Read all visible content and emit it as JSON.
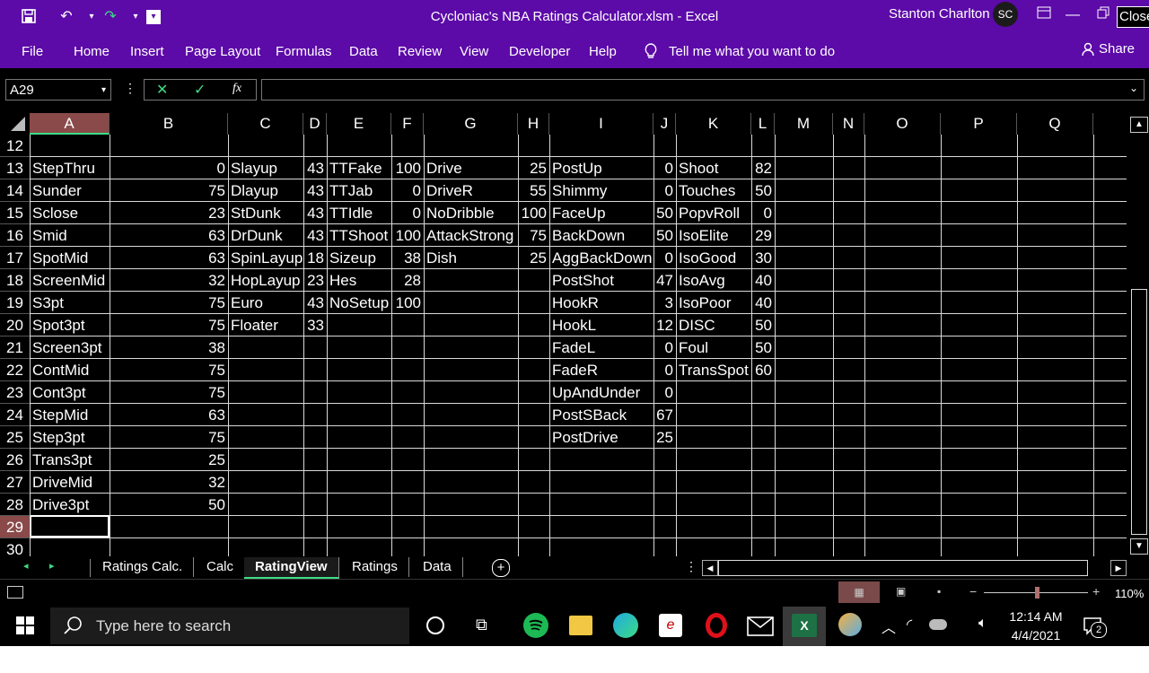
{
  "window": {
    "title": "Cycloniac's NBA Ratings Calculator.xlsm  -  Excel",
    "user_name": "Stanton Charlton",
    "user_initials": "SC",
    "close_label": "Close"
  },
  "ribbon": {
    "tabs": [
      "File",
      "Home",
      "Insert",
      "Page Layout",
      "Formulas",
      "Data",
      "Review",
      "View",
      "Developer",
      "Help"
    ],
    "tell_me": "Tell me what you want to do",
    "share": "Share"
  },
  "formula_bar": {
    "name_box": "A29",
    "fx": "fx",
    "value": ""
  },
  "columns": [
    "A",
    "B",
    "C",
    "D",
    "E",
    "F",
    "G",
    "H",
    "I",
    "J",
    "K",
    "L",
    "M",
    "N",
    "O",
    "P",
    "Q"
  ],
  "rows": [
    {
      "n": "12",
      "cells": [
        "",
        "",
        "",
        "",
        "",
        "",
        "",
        "",
        "",
        "",
        "",
        ""
      ]
    },
    {
      "n": "13",
      "cells": [
        "StepThru",
        "0",
        "Slayup",
        "43",
        "TTFake",
        "100",
        "Drive",
        "25",
        "PostUp",
        "0",
        "Shoot",
        "82"
      ]
    },
    {
      "n": "14",
      "cells": [
        "Sunder",
        "75",
        "Dlayup",
        "43",
        "TTJab",
        "0",
        "DriveR",
        "55",
        "Shimmy",
        "0",
        "Touches",
        "50"
      ]
    },
    {
      "n": "15",
      "cells": [
        "Sclose",
        "23",
        "StDunk",
        "43",
        "TTIdle",
        "0",
        "NoDribble",
        "100",
        "FaceUp",
        "50",
        "PopvRoll",
        "0"
      ]
    },
    {
      "n": "16",
      "cells": [
        "Smid",
        "63",
        "DrDunk",
        "43",
        "TTShoot",
        "100",
        "AttackStrong",
        "75",
        "BackDown",
        "50",
        "IsoElite",
        "29"
      ]
    },
    {
      "n": "17",
      "cells": [
        "SpotMid",
        "63",
        "SpinLayup",
        "18",
        "Sizeup",
        "38",
        "Dish",
        "25",
        "AggBackDown",
        "0",
        "IsoGood",
        "30"
      ]
    },
    {
      "n": "18",
      "cells": [
        "ScreenMid",
        "32",
        "HopLayup",
        "23",
        "Hes",
        "28",
        "",
        "",
        "PostShot",
        "47",
        "IsoAvg",
        "40"
      ]
    },
    {
      "n": "19",
      "cells": [
        "S3pt",
        "75",
        "Euro",
        "43",
        "NoSetup",
        "100",
        "",
        "",
        "HookR",
        "3",
        "IsoPoor",
        "40"
      ]
    },
    {
      "n": "20",
      "cells": [
        "Spot3pt",
        "75",
        "Floater",
        "33",
        "",
        "",
        "",
        "",
        "HookL",
        "12",
        "DISC",
        "50"
      ]
    },
    {
      "n": "21",
      "cells": [
        "Screen3pt",
        "38",
        "",
        "",
        "",
        "",
        "",
        "",
        "FadeL",
        "0",
        "Foul",
        "50"
      ]
    },
    {
      "n": "22",
      "cells": [
        "ContMid",
        "75",
        "",
        "",
        "",
        "",
        "",
        "",
        "FadeR",
        "0",
        "TransSpot",
        "60"
      ]
    },
    {
      "n": "23",
      "cells": [
        "Cont3pt",
        "75",
        "",
        "",
        "",
        "",
        "",
        "",
        "UpAndUnder",
        "0",
        "",
        ""
      ]
    },
    {
      "n": "24",
      "cells": [
        "StepMid",
        "63",
        "",
        "",
        "",
        "",
        "",
        "",
        "PostSBack",
        "67",
        "",
        ""
      ]
    },
    {
      "n": "25",
      "cells": [
        "Step3pt",
        "75",
        "",
        "",
        "",
        "",
        "",
        "",
        "PostDrive",
        "25",
        "",
        ""
      ]
    },
    {
      "n": "26",
      "cells": [
        "Trans3pt",
        "25",
        "",
        "",
        "",
        "",
        "",
        "",
        "",
        "",
        "",
        ""
      ]
    },
    {
      "n": "27",
      "cells": [
        "DriveMid",
        "32",
        "",
        "",
        "",
        "",
        "",
        "",
        "",
        "",
        "",
        ""
      ]
    },
    {
      "n": "28",
      "cells": [
        "Drive3pt",
        "50",
        "",
        "",
        "",
        "",
        "",
        "",
        "",
        "",
        "",
        ""
      ]
    },
    {
      "n": "29",
      "cells": [
        "",
        "",
        "",
        "",
        "",
        "",
        "",
        "",
        "",
        "",
        "",
        ""
      ]
    },
    {
      "n": "30",
      "cells": [
        "",
        "",
        "",
        "",
        "",
        "",
        "",
        "",
        "",
        "",
        "",
        ""
      ]
    }
  ],
  "sheets": [
    "Ratings Calc.",
    "Calc",
    "RatingView",
    "Ratings",
    "Data"
  ],
  "active_sheet": "RatingView",
  "zoom": "110%",
  "taskbar": {
    "search_placeholder": "Type here to search",
    "time": "12:14 AM",
    "date": "4/4/2021",
    "notifications": "2"
  },
  "colors": {
    "title_bar": "#5c0aa8",
    "sheet_bg": "#000000",
    "grid": "#d9d9d9"
  }
}
